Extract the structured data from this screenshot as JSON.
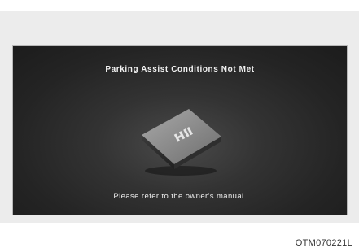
{
  "screen": {
    "title": "Parking Assist Conditions Not Met",
    "message": "Please refer to the owner's manual."
  },
  "image": {
    "icon": "smart-key-icon"
  },
  "caption": "OTM070221L"
}
